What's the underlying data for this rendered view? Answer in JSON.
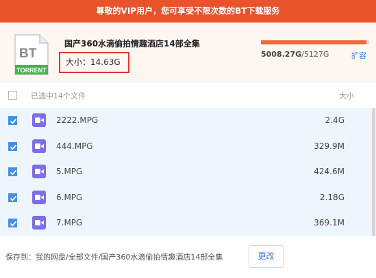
{
  "banner": {
    "text": "尊敬的VIP用户，您可享受不限次数的BT下载服务"
  },
  "torrent": {
    "icon_top": "BT",
    "icon_label": "TORRENT",
    "title": "国产360水滴偷拍情趣酒店14部全集",
    "size_label": "大小：14.63G"
  },
  "quota": {
    "used": "5008.27G",
    "total": "/5127G",
    "used_fraction": 0.977,
    "expand_label": "扩容",
    "colors": {
      "fill": "#ef6a3a",
      "track": "#f2d3c6"
    }
  },
  "list_header": {
    "selected_text": "已选中14个文件",
    "size_header": "大小"
  },
  "files": [
    {
      "name": "2222.MPG",
      "size": "2.4G",
      "checked": true
    },
    {
      "name": "444.MPG",
      "size": "329.9M",
      "checked": true
    },
    {
      "name": "5.MPG",
      "size": "424.6M",
      "checked": true
    },
    {
      "name": "6.MPG",
      "size": "2.18G",
      "checked": true
    },
    {
      "name": "7.MPG",
      "size": "369.1M",
      "checked": true
    }
  ],
  "save": {
    "path_text": "保存到：我的网盘/全部文件/国产360水滴偷拍情趣酒店14部全集",
    "change_label": "更改"
  },
  "colors": {
    "banner": "#e8532c",
    "accent": "#4a90e2",
    "video_icon": "#7b6ee6",
    "highlight_border": "#e03535"
  }
}
